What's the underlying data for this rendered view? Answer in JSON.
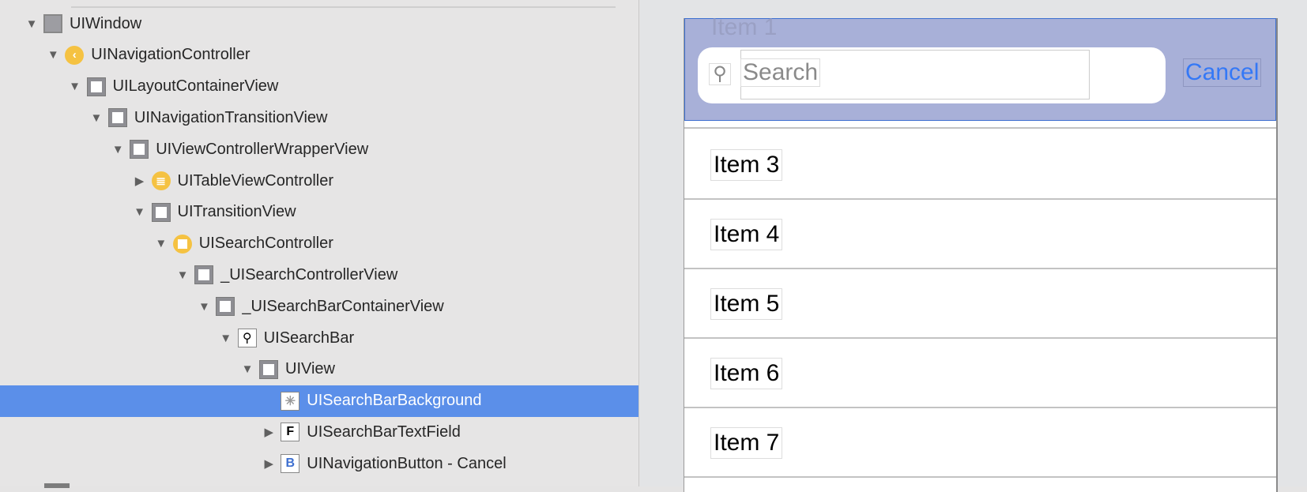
{
  "hierarchy": [
    {
      "label": "UIWindow",
      "level": 0,
      "expanded": true,
      "icon": "window-icon"
    },
    {
      "label": "UINavigationController",
      "level": 1,
      "expanded": true,
      "icon": "navigation-controller-icon"
    },
    {
      "label": "UILayoutContainerView",
      "level": 2,
      "expanded": true,
      "icon": "view-icon"
    },
    {
      "label": "UINavigationTransitionView",
      "level": 3,
      "expanded": true,
      "icon": "view-icon"
    },
    {
      "label": "UIViewControllerWrapperView",
      "level": 4,
      "expanded": true,
      "icon": "view-icon"
    },
    {
      "label": "UITableViewController",
      "level": 5,
      "expanded": false,
      "icon": "table-view-controller-icon"
    },
    {
      "label": "UITransitionView",
      "level": 5,
      "expanded": true,
      "icon": "view-icon"
    },
    {
      "label": "UISearchController",
      "level": 6,
      "expanded": true,
      "icon": "view-controller-icon"
    },
    {
      "label": "_UISearchControllerView",
      "level": 7,
      "expanded": true,
      "icon": "view-icon"
    },
    {
      "label": "_UISearchBarContainerView",
      "level": 8,
      "expanded": true,
      "icon": "view-icon"
    },
    {
      "label": "UISearchBar",
      "level": 9,
      "expanded": true,
      "icon": "search-bar-icon"
    },
    {
      "label": "UIView",
      "level": 10,
      "expanded": true,
      "icon": "view-icon"
    },
    {
      "label": "UISearchBarBackground",
      "level": 11,
      "expanded": null,
      "icon": "image-view-icon",
      "selected": true
    },
    {
      "label": "UISearchBarTextField",
      "level": 11,
      "expanded": false,
      "icon": "text-field-icon"
    },
    {
      "label": "UINavigationButton - Cancel",
      "level": 11,
      "expanded": false,
      "icon": "button-icon"
    }
  ],
  "preview": {
    "ghost_item": "Item 1",
    "search_placeholder": "Search",
    "cancel_label": "Cancel",
    "items": [
      "Item 3",
      "Item 4",
      "Item 5",
      "Item 6",
      "Item 7"
    ]
  },
  "colors": {
    "selection": "#5b8fe9",
    "highlight_overlay": "#a8b0d8",
    "cancel": "#3478f6"
  }
}
